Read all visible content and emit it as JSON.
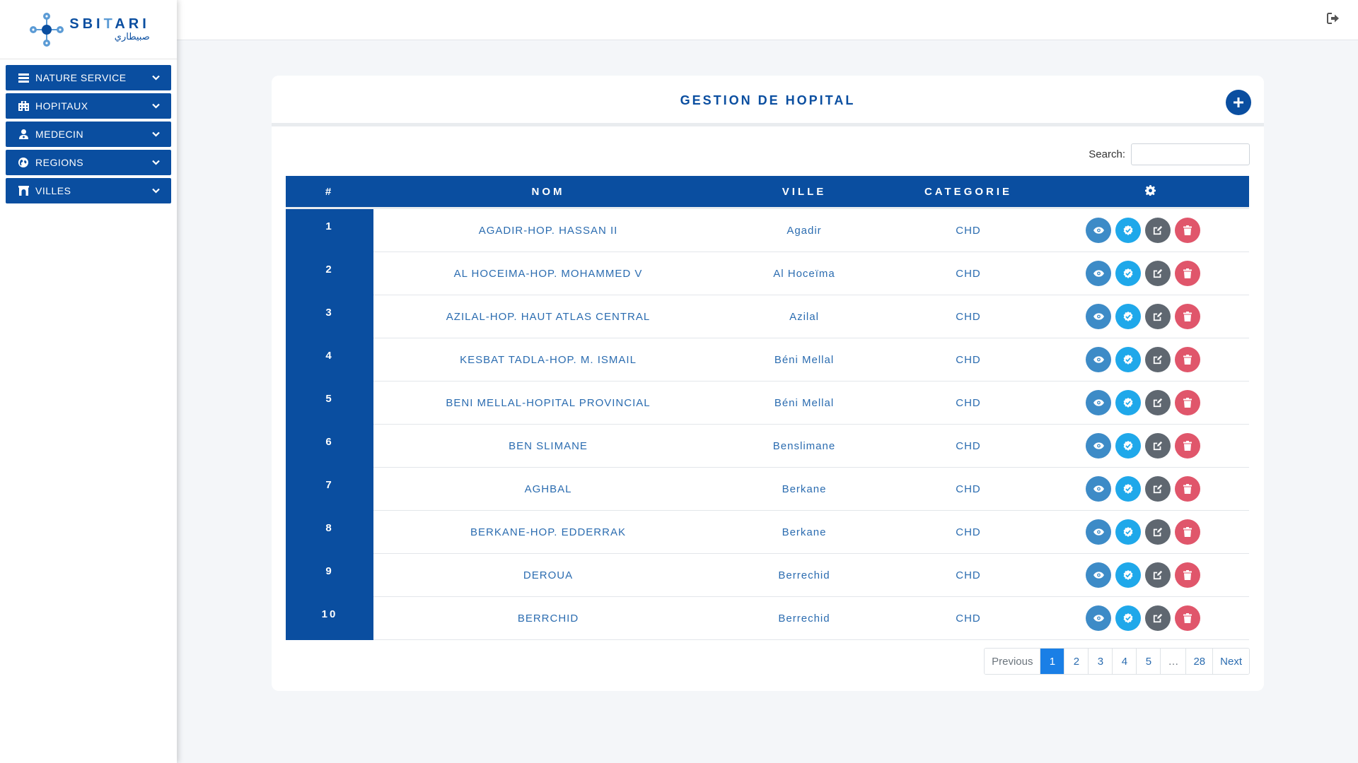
{
  "logo": {
    "latin_prefix": "SBI",
    "latin_mid": "T",
    "latin_suffix": "ARI",
    "arabic": "صبيطاري"
  },
  "sidebar": {
    "items": [
      {
        "label": "NATURE SERVICE",
        "icon": "table-icon"
      },
      {
        "label": "HOPITAUX",
        "icon": "hospital-icon"
      },
      {
        "label": "MEDECIN",
        "icon": "user-md-icon"
      },
      {
        "label": "REGIONS",
        "icon": "globe-icon"
      },
      {
        "label": "VILLES",
        "icon": "archway-icon"
      }
    ]
  },
  "topbar": {
    "logout_icon": "sign-out-icon"
  },
  "card": {
    "title": "GESTION DE HOPITAL",
    "add_icon": "plus-icon"
  },
  "search": {
    "label": "Search:",
    "value": "",
    "placeholder": ""
  },
  "table": {
    "headers": {
      "num": "#",
      "nom": "NOM",
      "ville": "VILLE",
      "categorie": "CATEGORIE",
      "actions_icon": "gear-icon"
    },
    "rows": [
      {
        "num": "1",
        "nom": "AGADIR-HOP. HASSAN II",
        "ville": "Agadir",
        "categorie": "CHD"
      },
      {
        "num": "2",
        "nom": "AL HOCEIMA-HOP. MOHAMMED V",
        "ville": "Al Hoceïma",
        "categorie": "CHD"
      },
      {
        "num": "3",
        "nom": "AZILAL-HOP. HAUT ATLAS CENTRAL",
        "ville": "Azilal",
        "categorie": "CHD"
      },
      {
        "num": "4",
        "nom": "KESBAT TADLA-HOP. M. ISMAIL",
        "ville": "Béni Mellal",
        "categorie": "CHD"
      },
      {
        "num": "5",
        "nom": "BENI MELLAL-HOPITAL PROVINCIAL",
        "ville": "Béni Mellal",
        "categorie": "CHD"
      },
      {
        "num": "6",
        "nom": "BEN SLIMANE",
        "ville": "Benslimane",
        "categorie": "CHD"
      },
      {
        "num": "7",
        "nom": "AGHBAL",
        "ville": "Berkane",
        "categorie": "CHD"
      },
      {
        "num": "8",
        "nom": "BERKANE-HOP. EDDERRAK",
        "ville": "Berkane",
        "categorie": "CHD"
      },
      {
        "num": "9",
        "nom": "DEROUA",
        "ville": "Berrechid",
        "categorie": "CHD"
      },
      {
        "num": "10",
        "nom": "BERRCHID",
        "ville": "Berrechid",
        "categorie": "CHD"
      }
    ]
  },
  "pagination": {
    "previous": "Previous",
    "pages": [
      "1",
      "2",
      "3",
      "4",
      "5",
      "…",
      "28"
    ],
    "active": "1",
    "next": "Next"
  },
  "colors": {
    "primary": "#0a4ea0",
    "view": "#3d8bc7",
    "validate": "#1fa8ea",
    "edit": "#5f6770",
    "delete": "#e0566b",
    "active_page": "#1a7fe6"
  }
}
